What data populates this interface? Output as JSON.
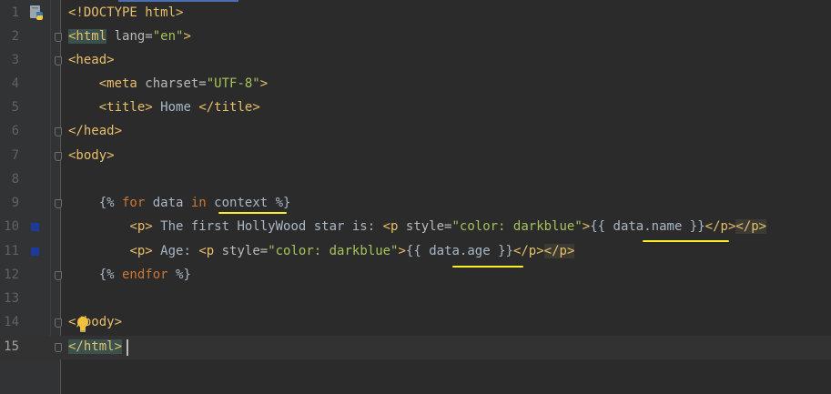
{
  "editor": {
    "gutter": {
      "file_icon": "python-file-icon",
      "bulb_icon": "lightbulb-icon",
      "bookmark_color": "#1a3a9e"
    },
    "lines": [
      {
        "number": "1"
      },
      {
        "number": "2"
      },
      {
        "number": "3"
      },
      {
        "number": "4"
      },
      {
        "number": "5"
      },
      {
        "number": "6"
      },
      {
        "number": "7"
      },
      {
        "number": "8"
      },
      {
        "number": "9"
      },
      {
        "number": "10"
      },
      {
        "number": "11"
      },
      {
        "number": "12"
      },
      {
        "number": "13"
      },
      {
        "number": "14"
      },
      {
        "number": "15"
      }
    ],
    "code": {
      "l1": {
        "t1": "<!DOCTYPE html>"
      },
      "l2": {
        "t1": "<html",
        "t2": " lang=",
        "t3": "\"en\"",
        "t4": ">"
      },
      "l3": {
        "t1": "<head>"
      },
      "l4": {
        "indent": "    ",
        "t1": "<meta",
        "t2": " charset=",
        "t3": "\"UTF-8\"",
        "t4": ">"
      },
      "l5": {
        "indent": "    ",
        "t1": "<title>",
        "t2": " Home ",
        "t3": "</title>"
      },
      "l6": {
        "t1": "</head>"
      },
      "l7": {
        "t1": "<body>"
      },
      "l9": {
        "indent": "    ",
        "t1": "{%",
        "t2": " for ",
        "t3": "data",
        "t4": " in ",
        "t5": "context",
        "t6": " %}"
      },
      "l10": {
        "indent": "        ",
        "t1": "<p>",
        "t2": " The first HollyWood star is: ",
        "t3": "<p",
        "t4": " style=",
        "t5": "\"color: darkblue\"",
        "t6": ">",
        "t7": "{{ ",
        "t8": "data.name",
        "t9": " }}",
        "t10": "</p>",
        "t11": "</p>"
      },
      "l11": {
        "indent": "        ",
        "t1": "<p>",
        "t2": " Age: ",
        "t3": "<p",
        "t4": " style=",
        "t5": "\"color: darkblue\"",
        "t6": ">",
        "t7": "{{ ",
        "t8": "data.age",
        "t9": " }}",
        "t10": "</p>",
        "t11": "</p>"
      },
      "l12": {
        "indent": "    ",
        "t1": "{%",
        "t2": " endfor ",
        "t3": "%}"
      },
      "l14": {
        "t1": "</body>"
      },
      "l15": {
        "t1": "</html>"
      }
    },
    "colors": {
      "background": "#2b2b2b",
      "tag": "#e8bf6a",
      "string": "#a5c25c",
      "keyword": "#cc7832",
      "text": "#a9b7c6",
      "underline": "#ffef28"
    }
  }
}
